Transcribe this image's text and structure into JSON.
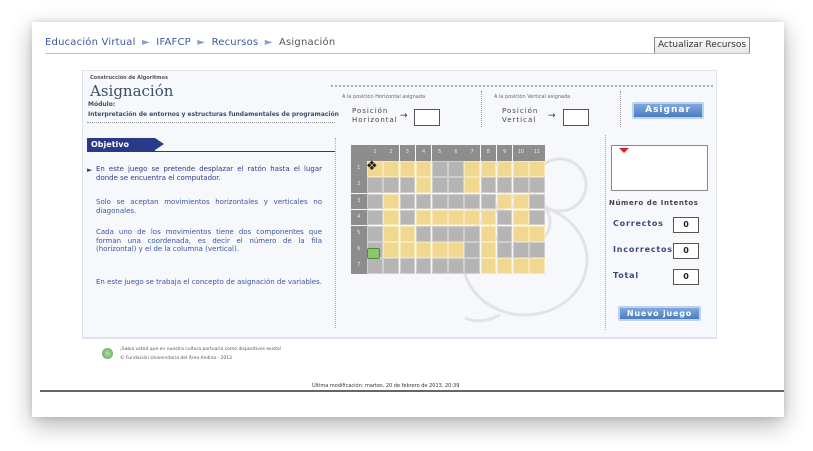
{
  "breadcrumb": {
    "items": [
      "Educación Virtual",
      "IFAFCP",
      "Recursos",
      "Asignación"
    ],
    "separator": "►"
  },
  "header": {
    "update_button": "Actualizar Recursos"
  },
  "module": {
    "small_label": "Construcción de Algoritmos",
    "title": "Asignación",
    "modulo_label": "Módulo:",
    "modulo_text": "Interpretación de entornos y estructuras fundamentales de programación"
  },
  "assign": {
    "horizontal_caption": "A la posición Horizontal asignada",
    "vertical_caption": "A la posición Vertical asignada",
    "horizontal_label_1": "Posición",
    "horizontal_label_2": "Horizontal",
    "vertical_label_1": "Posición",
    "vertical_label_2": "Vertical",
    "arrow": "→",
    "horizontal_value": "",
    "vertical_value": "",
    "assign_button": "Asignar"
  },
  "objective": {
    "tab": "Objetivo",
    "paragraphs": [
      "En este juego se pretende desplazar el ratón hasta el lugar donde se encuentra el computador.",
      "Solo se aceptan movimientos horizontales y verticales no diagonales.",
      "Cada uno de los movimientos tiene dos componentes que forman una coordenada, es decir el número de la fila (horizontal) y el de la columna (vertical).",
      "En este juego se trabaja el concepto de asignación de variables."
    ]
  },
  "grid": {
    "column_headers": [
      "1",
      "2",
      "3",
      "4",
      "5",
      "6",
      "7",
      "8",
      "9",
      "10",
      "11"
    ],
    "row_headers": [
      "1",
      "2",
      "3",
      "4",
      "5",
      "6",
      "7"
    ],
    "cursor_icon": "cursor-icon",
    "target_icon": "computer-icon",
    "colors": {
      "path": "#f0d890",
      "wall": "#b5b5b5",
      "header": "#8d8d8d"
    }
  },
  "stats": {
    "title": "Número de Intentos",
    "correct_label": "Correctos",
    "correct_value": "0",
    "incorrect_label": "Incorrectos",
    "incorrect_value": "0",
    "total_label": "Total",
    "total_value": "0",
    "new_game_button": "Nuevo juego"
  },
  "footer": {
    "line1": "¡Sabía usted que en nuestra cultura portuaria como dispositivos existe!",
    "line2": "© Fundación Universitaria del Área Andina · 2013",
    "last_modified": "Última modificación: martes, 20 de febrero de 2013, 20:39"
  }
}
